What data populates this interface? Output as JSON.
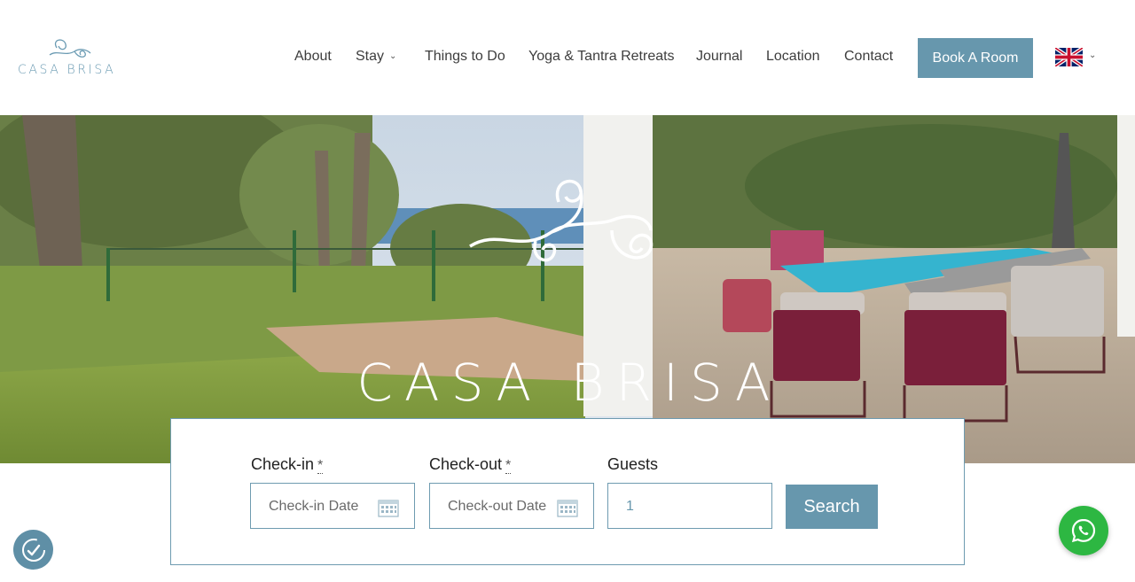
{
  "header": {
    "logo_text": "CASA BRISA",
    "nav": [
      {
        "label": "About",
        "has_dropdown": false
      },
      {
        "label": "Stay",
        "has_dropdown": true
      },
      {
        "label": "Things to Do",
        "has_dropdown": false
      },
      {
        "label": "Yoga & Tantra Retreats",
        "has_dropdown": false
      },
      {
        "label": "Journal",
        "has_dropdown": false
      },
      {
        "label": "Location",
        "has_dropdown": false
      },
      {
        "label": "Contact",
        "has_dropdown": false
      }
    ],
    "book_button": "Book A Room",
    "language_icon": "uk-flag-icon"
  },
  "hero": {
    "title": "CASA BRISA",
    "image": "villa-garden-pool-photo"
  },
  "booking": {
    "checkin_label": "Check-in",
    "checkout_label": "Check-out",
    "guests_label": "Guests",
    "required_mark": "*",
    "checkin_placeholder": "Check-in Date",
    "checkout_placeholder": "Check-out Date",
    "guests_value": "1",
    "search_button": "Search"
  },
  "floating": {
    "accessibility_icon": "accessibility-icon",
    "whatsapp_icon": "whatsapp-icon"
  },
  "colors": {
    "accent": "#6797ad",
    "logo": "#6b9bb3",
    "whatsapp": "#2db742"
  }
}
